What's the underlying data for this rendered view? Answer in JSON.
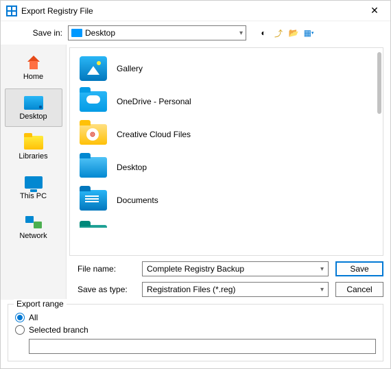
{
  "title": "Export Registry File",
  "savein": {
    "label": "Save in:",
    "value": "Desktop"
  },
  "toolbar": {
    "back": "◐",
    "up": "⬆",
    "newfolder": "📁",
    "views": "▦"
  },
  "places": [
    {
      "label": "Home",
      "icon": "home"
    },
    {
      "label": "Desktop",
      "icon": "desktop",
      "selected": true
    },
    {
      "label": "Libraries",
      "icon": "libraries"
    },
    {
      "label": "This PC",
      "icon": "thispc"
    },
    {
      "label": "Network",
      "icon": "network"
    }
  ],
  "files": [
    {
      "label": "Gallery",
      "icon": "gallery"
    },
    {
      "label": "OneDrive - Personal",
      "icon": "onedrive"
    },
    {
      "label": "Creative Cloud Files",
      "icon": "creativecloud"
    },
    {
      "label": "Desktop",
      "icon": "desktopf"
    },
    {
      "label": "Documents",
      "icon": "documents"
    },
    {
      "label": "",
      "icon": "green-partial"
    }
  ],
  "filename": {
    "label": "File name:",
    "value": "Complete Registry Backup"
  },
  "saveastype": {
    "label": "Save as type:",
    "value": "Registration Files (*.reg)"
  },
  "buttons": {
    "save": "Save",
    "cancel": "Cancel"
  },
  "export": {
    "legend": "Export range",
    "all": "All",
    "selected": "Selected branch",
    "branch_value": ""
  }
}
